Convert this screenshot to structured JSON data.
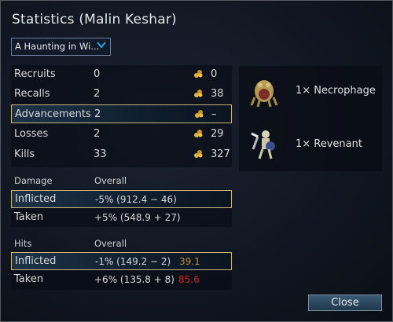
{
  "window": {
    "title": "Statistics (Malin Keshar)"
  },
  "scenario_select": {
    "value": "A Haunting in Wi..."
  },
  "stats": [
    {
      "label": "Recruits",
      "value": "0",
      "gold": "0"
    },
    {
      "label": "Recalls",
      "value": "2",
      "gold": "38"
    },
    {
      "label": "Advancements",
      "value": "2",
      "gold": "–"
    },
    {
      "label": "Losses",
      "value": "2",
      "gold": "29"
    },
    {
      "label": "Kills",
      "value": "33",
      "gold": "327"
    }
  ],
  "damage": {
    "header_left": "Damage",
    "header_right": "Overall",
    "rows": [
      {
        "label": "Inflicted",
        "value": "-5% (912.4 − 46)"
      },
      {
        "label": "Taken",
        "value": "+5% (548.9 + 27)"
      }
    ]
  },
  "hits": {
    "header_left": "Hits",
    "header_right": "Overall",
    "rows": [
      {
        "label": "Inflicted",
        "value": "-1% (149.2 − 2)",
        "extra": "39.1",
        "extra_color": "#c98a2a"
      },
      {
        "label": "Taken",
        "value": "+6% (135.8 + 8)",
        "extra": "85.6",
        "extra_color": "#c8291e"
      }
    ]
  },
  "units": [
    {
      "label": "1× Necrophage",
      "icon": "necrophage-portrait"
    },
    {
      "label": "1× Revenant",
      "icon": "revenant-portrait"
    }
  ],
  "close_label": "Close",
  "colors": {
    "gold": "#e2b33b",
    "accent": "#2ea7e8",
    "selection_border": "#c9b877"
  }
}
